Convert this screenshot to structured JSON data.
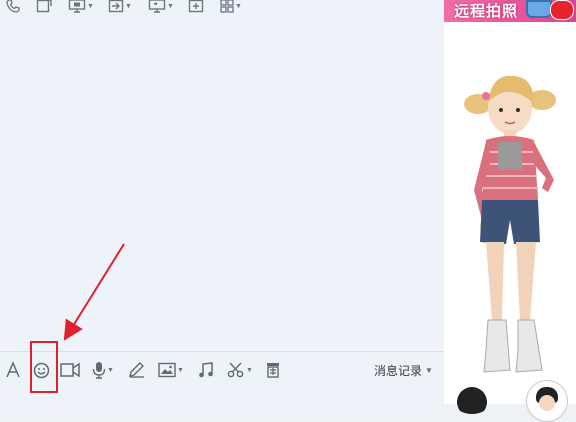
{
  "top_toolbar": {
    "icons": [
      "phone-icon",
      "share-file-icon",
      "screen-share-icon",
      "send-file-icon",
      "remote-desktop-icon",
      "add-icon",
      "apps-grid-icon"
    ]
  },
  "bottom_toolbar": {
    "icons": [
      "font-icon",
      "emoji-icon",
      "video-icon",
      "microphone-icon",
      "pen-icon",
      "image-icon",
      "music-icon",
      "scissors-icon",
      "archive-icon"
    ],
    "history_label": "消息记录"
  },
  "ad_banner": {
    "text": "远程拍照"
  },
  "colors": {
    "chat_background": "#eef3f9",
    "icon_gray": "#6b7683",
    "highlight_red": "#e0202a",
    "banner_pink": "#e8559a"
  }
}
